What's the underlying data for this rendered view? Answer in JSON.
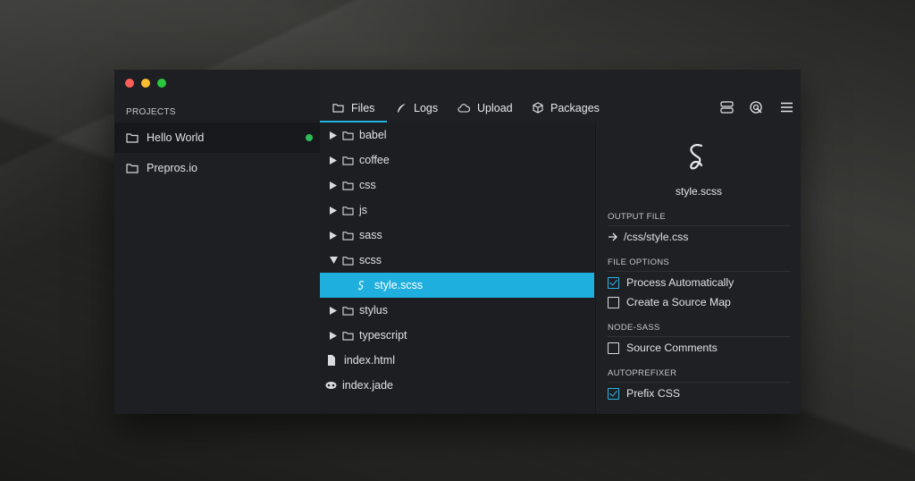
{
  "sidebar": {
    "heading": "PROJECTS",
    "projects": [
      {
        "label": "Hello World",
        "active": true,
        "status_color": "#2dbb5a"
      },
      {
        "label": "Prepros.io",
        "active": false
      }
    ]
  },
  "tabs": [
    {
      "label": "Files",
      "icon": "folder-icon",
      "active": true
    },
    {
      "label": "Logs",
      "icon": "feather-icon"
    },
    {
      "label": "Upload",
      "icon": "cloud-icon"
    },
    {
      "label": "Packages",
      "icon": "package-icon"
    }
  ],
  "toolbar_icons": [
    "server-icon",
    "target-icon",
    "menu-icon"
  ],
  "files": [
    {
      "label": "babel",
      "type": "folder"
    },
    {
      "label": "coffee",
      "type": "folder"
    },
    {
      "label": "css",
      "type": "folder"
    },
    {
      "label": "js",
      "type": "folder"
    },
    {
      "label": "sass",
      "type": "folder"
    },
    {
      "label": "scss",
      "type": "folder-open"
    },
    {
      "label": "style.scss",
      "type": "sass-file",
      "selected": true
    },
    {
      "label": "stylus",
      "type": "folder"
    },
    {
      "label": "typescript",
      "type": "folder"
    },
    {
      "label": "index.html",
      "type": "html-file"
    },
    {
      "label": "index.jade",
      "type": "jade-file"
    }
  ],
  "detail": {
    "file_name": "style.scss",
    "output_heading": "OUTPUT FILE",
    "output_path": "/css/style.css",
    "file_options_heading": "FILE OPTIONS",
    "process_automatically": "Process Automatically",
    "source_map": "Create a Source Map",
    "node_sass_heading": "NODE-SASS",
    "source_comments": "Source Comments",
    "autoprefixer_heading": "AUTOPREFIXER",
    "prefix_css": "Prefix CSS"
  },
  "colors": {
    "accent": "#1fafde",
    "close": "#fc5f57",
    "minimize": "#fdbc2e",
    "zoom": "#28c940"
  }
}
